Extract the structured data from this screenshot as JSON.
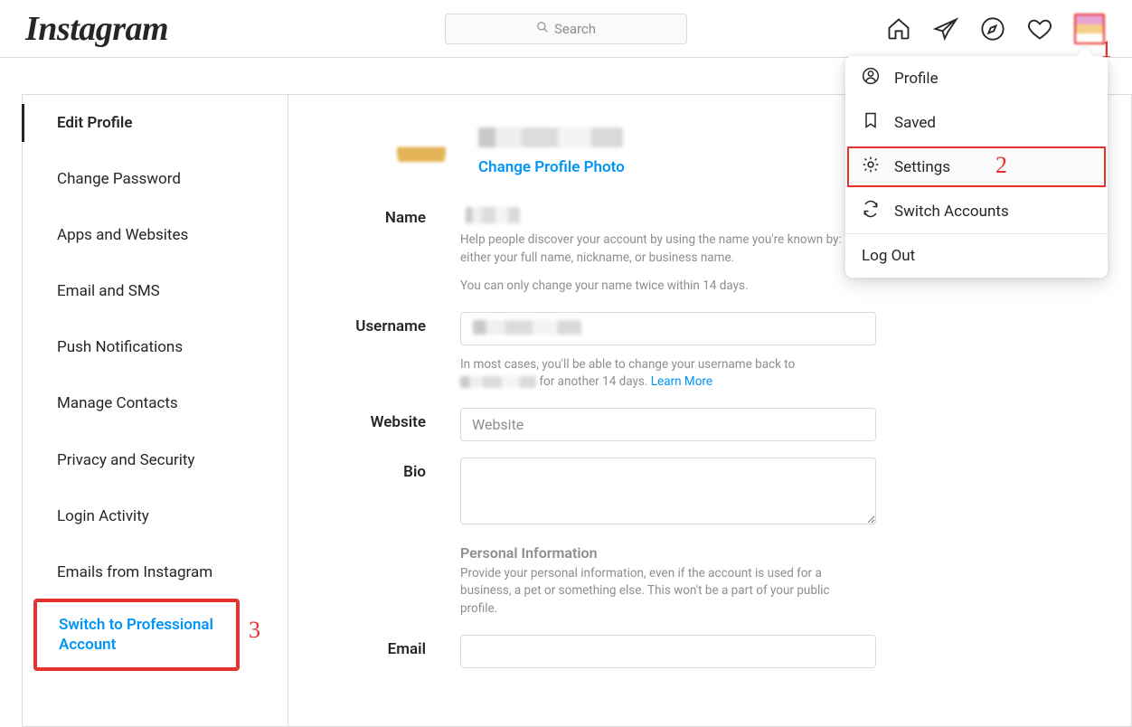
{
  "brand": "Instagram",
  "search": {
    "placeholder": "Search"
  },
  "dropdown": {
    "items": [
      {
        "label": "Profile"
      },
      {
        "label": "Saved"
      },
      {
        "label": "Settings"
      },
      {
        "label": "Switch Accounts"
      }
    ],
    "logout": "Log Out"
  },
  "annotations": {
    "a1": "1",
    "a2": "2",
    "a3": "3"
  },
  "sidebar": {
    "items": [
      "Edit Profile",
      "Change Password",
      "Apps and Websites",
      "Email and SMS",
      "Push Notifications",
      "Manage Contacts",
      "Privacy and Security",
      "Login Activity",
      "Emails from Instagram",
      "Switch to Professional Account"
    ]
  },
  "form": {
    "change_photo": "Change Profile Photo",
    "labels": {
      "name": "Name",
      "username": "Username",
      "website": "Website",
      "bio": "Bio",
      "email": "Email"
    },
    "placeholders": {
      "website": "Website"
    },
    "help": {
      "name1": "Help people discover your account by using the name you're known by: either your full name, nickname, or business name.",
      "name2": "You can only change your name twice within 14 days.",
      "username_pre": "In most cases, you'll be able to change your username back to ",
      "username_post": " for another 14 days. ",
      "learn_more": "Learn More",
      "personal_head": "Personal Information",
      "personal_body": "Provide your personal information, even if the account is used for a business, a pet or something else. This won't be a part of your public profile."
    }
  }
}
